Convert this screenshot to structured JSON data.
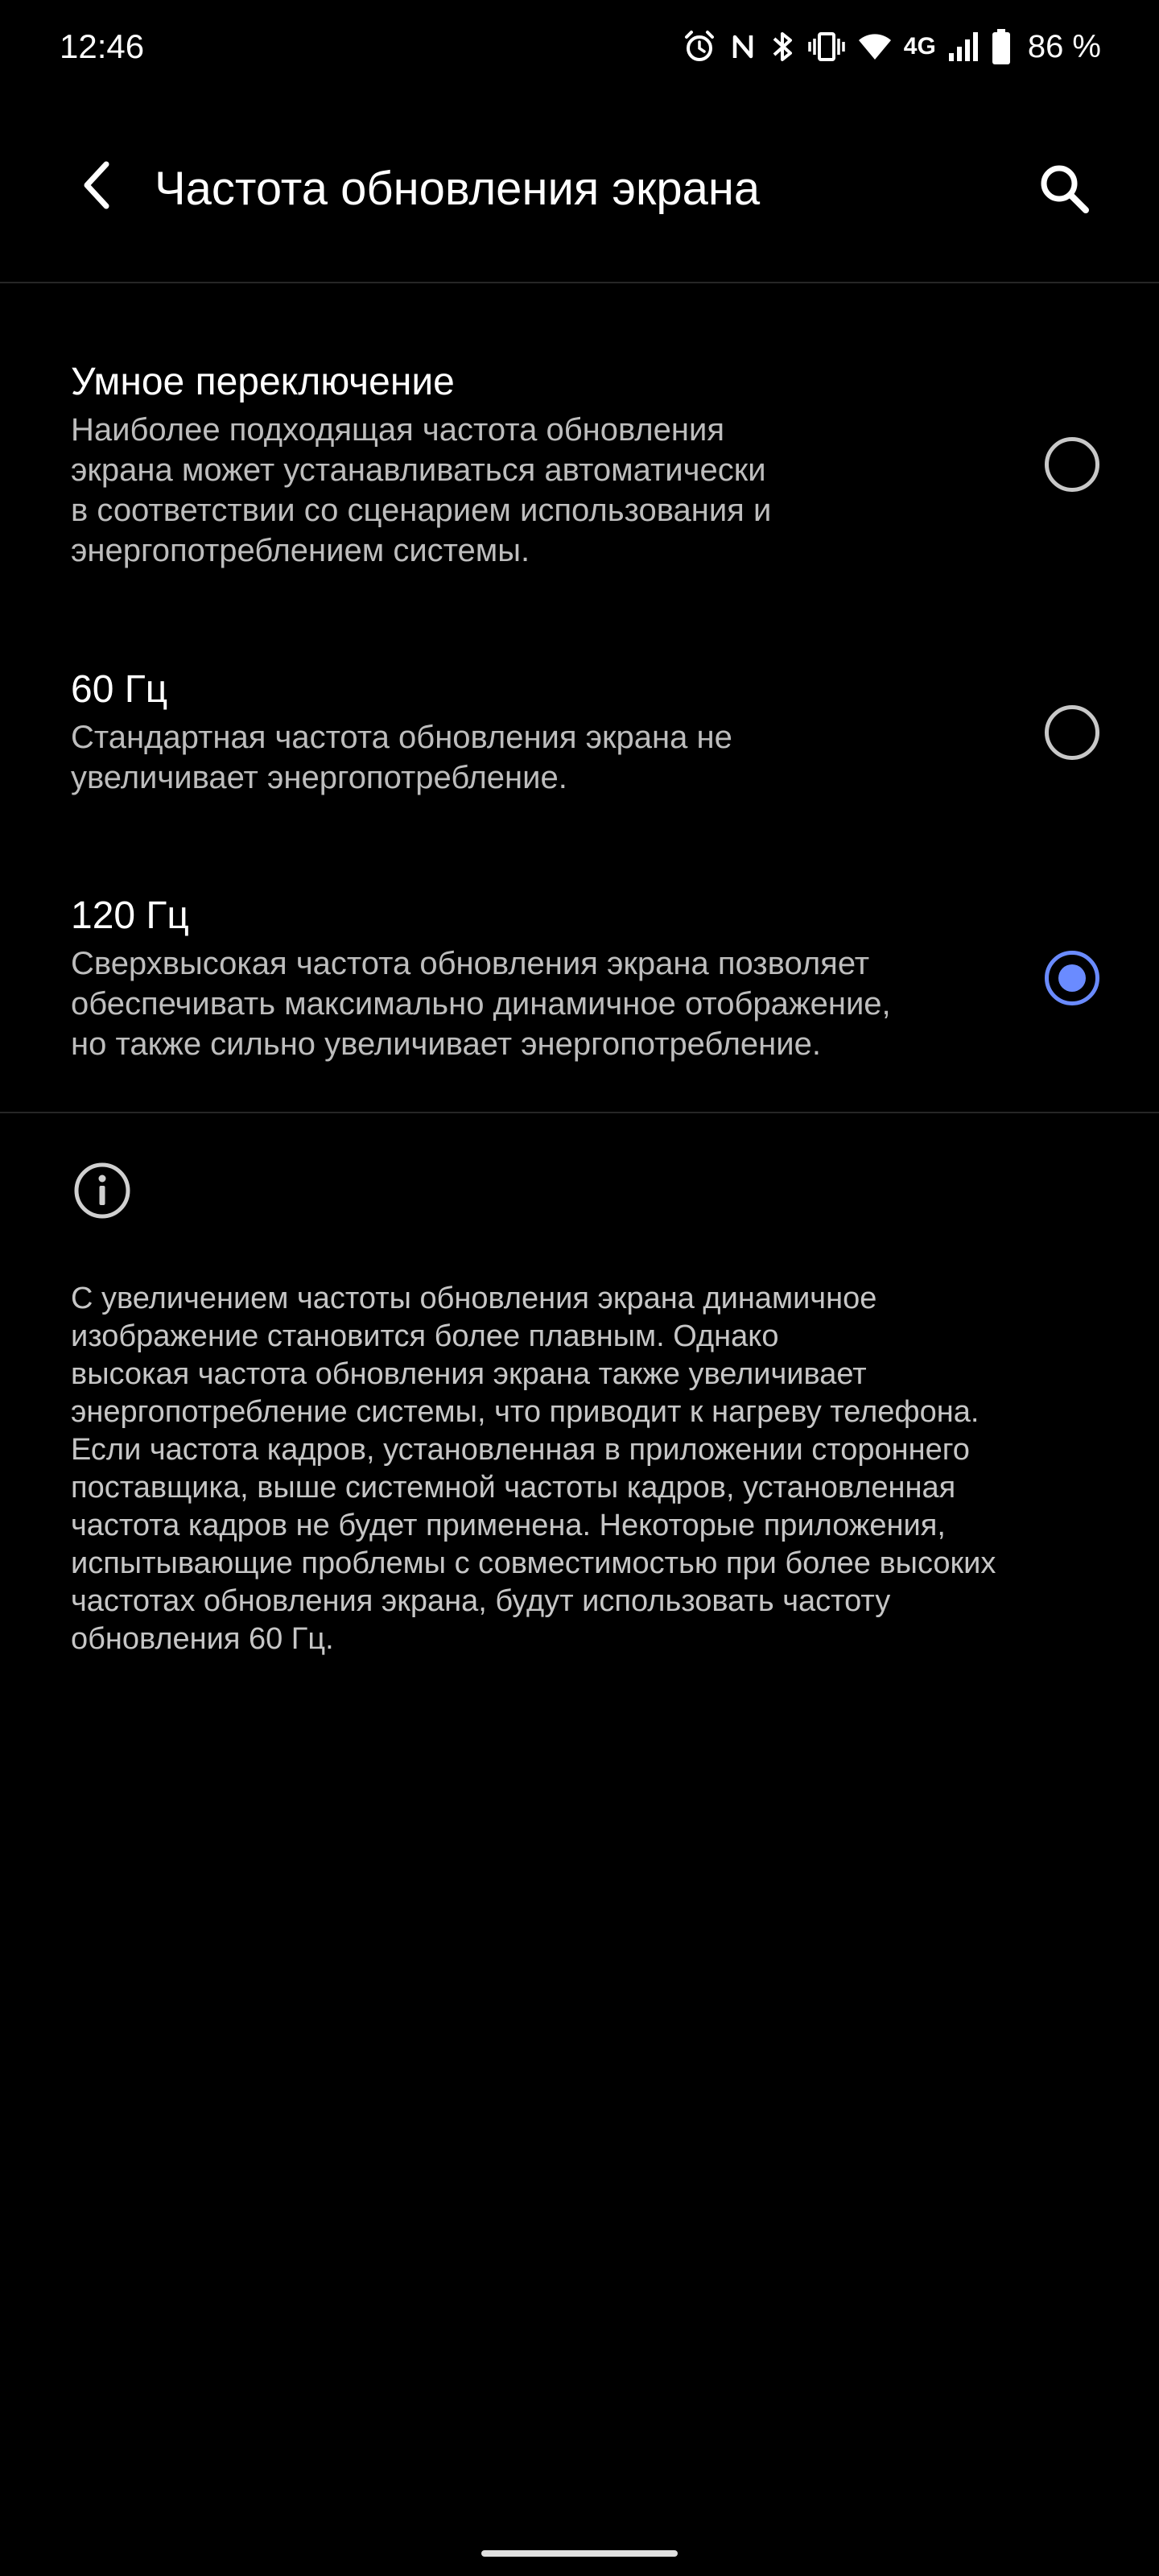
{
  "status_bar": {
    "time": "12:46",
    "network": "4G",
    "battery": "86 %",
    "icons": [
      "alarm-icon",
      "nfc-icon",
      "bluetooth-icon",
      "vibrate-icon",
      "wifi-icon",
      "signal-icon",
      "battery-icon"
    ]
  },
  "app_bar": {
    "title": "Частота обновления экрана",
    "back_icon": "back-arrow-icon",
    "search_icon": "search-icon"
  },
  "options": [
    {
      "title": "Умное переключение",
      "description": "Наиболее подходящая частота обновления\nэкрана может устанавливаться автоматически\nв соответствии со сценарием использования и\nэнергопотреблением системы.",
      "selected": false
    },
    {
      "title": "60 Гц",
      "description": "Стандартная частота обновления экрана не\nувеличивает энергопотребление.",
      "selected": false
    },
    {
      "title": "120 Гц",
      "description": "Сверхвысокая частота обновления экрана позволяет\nобеспечивать максимально динамичное отображение,\nно также сильно увеличивает энергопотребление.",
      "selected": true
    }
  ],
  "info": {
    "icon": "info-icon",
    "text": "С увеличением частоты обновления экрана динамичное\nизображение становится более плавным. Однако\nвысокая частота обновления экрана также увеличивает\nэнергопотребление системы, что приводит к нагреву телефона.\nЕсли частота кадров, установленная в приложении стороннего\nпоставщика, выше системной частоты кадров, установленная\nчастота кадров не будет применена. Некоторые приложения,\nиспытывающие проблемы с совместимостью при более высоких\nчастотах обновления экрана, будут использовать частоту\nобновления 60 Гц."
  },
  "colors": {
    "background": "#000000",
    "accent": "#6a8bff",
    "secondary_text": "#bdbdbd"
  }
}
